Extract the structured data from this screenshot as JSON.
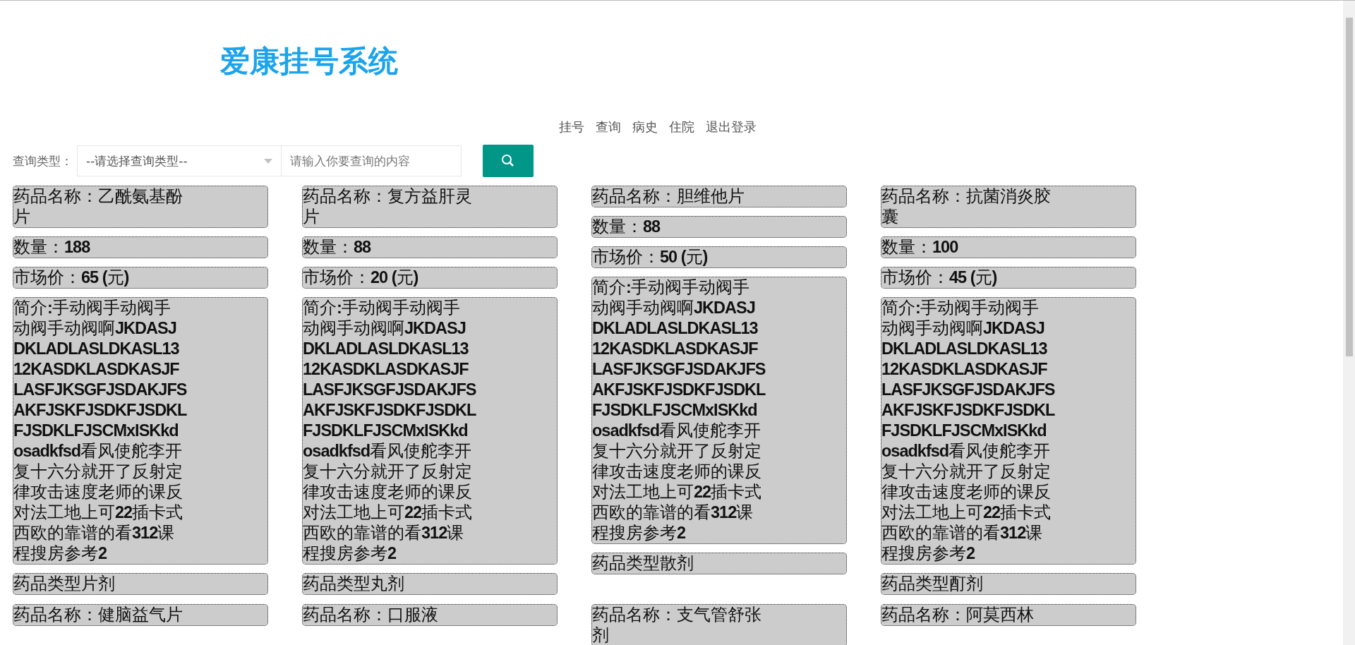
{
  "header": {
    "title": "爱康挂号系统"
  },
  "nav": [
    {
      "label": "挂号"
    },
    {
      "label": "查询"
    },
    {
      "label": "病史"
    },
    {
      "label": "住院"
    },
    {
      "label": "退出登录"
    }
  ],
  "search": {
    "label": "查询类型：",
    "select_value": "--请选择查询类型--",
    "placeholder": "请输入你要查询的内容"
  },
  "cards": [
    {
      "name": "药品名称：乙酰氨基酚片",
      "quantity": "数量：**188**",
      "price": "市场价：**65 (**元**)**",
      "description": "简介**:**手动阀手动阀手动阀手动阀啊**JKDASJDKLADLASLDKASL1312KASDKLASDKASJFLASFJKSGFJSDAKJFSAKFJSKFJSDKFJSDKLFJSDKLFJSCMxISKkdosadkfsd**看风使舵李开复十六分就开了反射定律攻击速度老师的课反对法工地上可**22**插卡式西欧的靠谱的看**312**课程搜房参考**2**",
      "type": "药品类型片剂"
    },
    {
      "name": "药品名称：复方益肝灵片",
      "quantity": "数量：**88**",
      "price": "市场价：**20 (**元**)**",
      "description": "简介**:**手动阀手动阀手动阀手动阀啊**JKDASJDKLADLASLDKASL1312KASDKLASDKASJFLASFJKSGFJSDAKJFSAKFJSKFJSDKFJSDKLFJSDKLFJSCMxISKkdosadkfsd**看风使舵李开复十六分就开了反射定律攻击速度老师的课反对法工地上可**22**插卡式西欧的靠谱的看**312**课程搜房参考**2**",
      "type": "药品类型丸剂"
    },
    {
      "name": "药品名称：胆维他片",
      "quantity": "数量：**88**",
      "price": "市场价：**50 (**元**)**",
      "description": "简介**:**手动阀手动阀手动阀手动阀啊**JKDASJDKLADLASLDKASL1312KASDKLASDKASJFLASFJKSGFJSDAKJFSAKFJSKFJSDKFJSDKLFJSDKLFJSCMxISKkdosadkfsd**看风使舵李开复十六分就开了反射定律攻击速度老师的课反对法工地上可**22**插卡式西欧的靠谱的看**312**课程搜房参考**2**",
      "type": "药品类型散剂"
    },
    {
      "name": "药品名称：抗菌消炎胶囊",
      "quantity": "数量：**100**",
      "price": "市场价：**45 (**元**)**",
      "description": "简介**:**手动阀手动阀手动阀手动阀啊**JKDASJDKLADLASLDKASL1312KASDKLASDKASJFLASFJKSGFJSDAKJFSAKFJSKFJSDKFJSDKLFJSDKLFJSCMxISKkdosadkfsd**看风使舵李开复十六分就开了反射定律攻击速度老师的课反对法工地上可**22**插卡式西欧的靠谱的看**312**课程搜房参考**2**",
      "type": "药品类型酊剂"
    },
    {
      "name": "药品名称：健脑益气片"
    },
    {
      "name": "药品名称：口服液"
    },
    {
      "name": "药品名称：支气管舒张剂"
    },
    {
      "name": "药品名称：阿莫西林"
    }
  ]
}
